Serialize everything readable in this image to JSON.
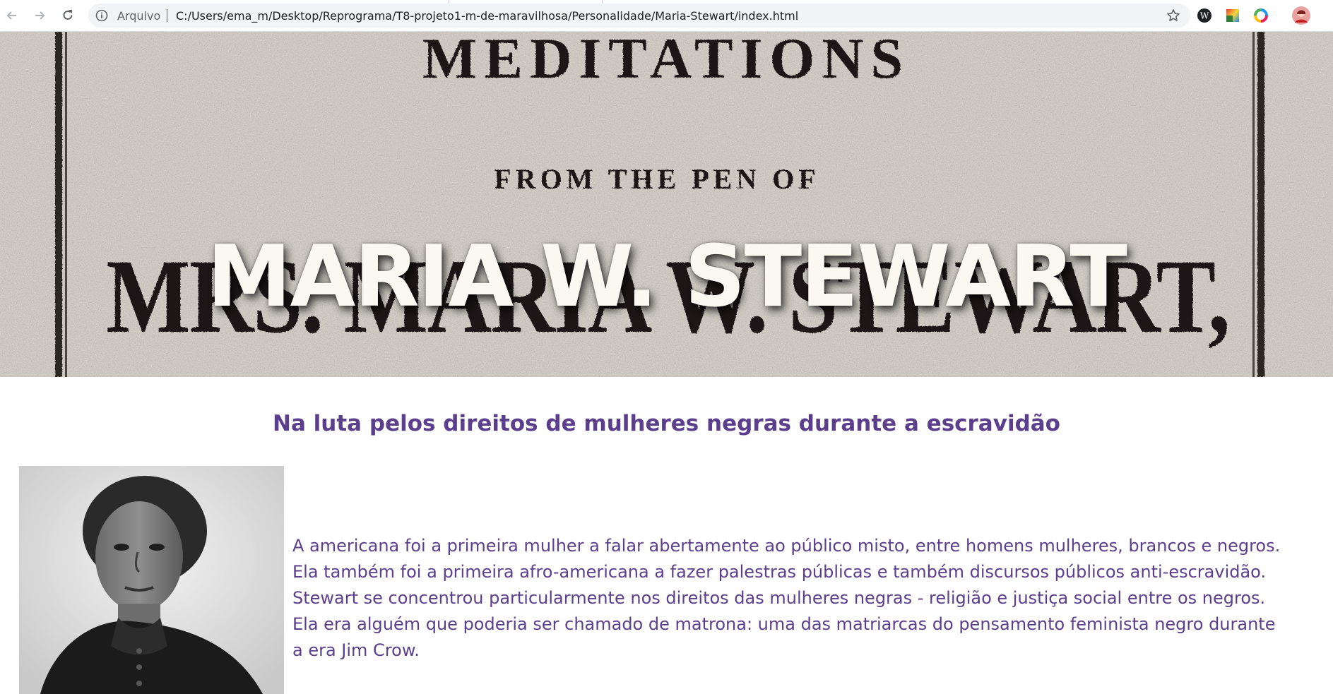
{
  "browser": {
    "scheme_label": "Arquivo",
    "url": "C:/Users/ema_m/Desktop/Reprograma/T8-projeto1-m-de-maravilhosa/Personalidade/Maria-Stewart/index.html",
    "icons": [
      "back-arrow-icon",
      "forward-arrow-icon",
      "reload-icon",
      "info-icon",
      "star-icon",
      "wikipedia-extension-icon",
      "color-extension-icon",
      "color-wheel-extension-icon",
      "profile-avatar-icon"
    ]
  },
  "hero": {
    "title": "MARIA W. STEWART",
    "background_text": {
      "line1": "MEDITATIONS",
      "line2": "FROM THE PEN OF",
      "line3": "MRS. MARIA W. STEWART,"
    }
  },
  "content": {
    "subtitle": "Na luta pelos direitos de mulheres negras durante a escravidão",
    "bio": "A americana foi a primeira mulher a falar abertamente ao público misto, entre homens mulheres, brancos e negros. Ela também foi a primeira afro-americana a fazer palestras públicas e também discursos públicos anti-escravidão. Stewart se concentrou particularmente nos direitos das mulheres negras - religião e justiça social entre os negros. Ela era alguém que poderia ser chamado de matrona: uma das matriarcas do pensamento feminista negro durante a era Jim Crow."
  },
  "colors": {
    "accent_purple": "#5b3f8d",
    "hero_title": "#fbf7f1",
    "paper": "#b9b5ac"
  }
}
